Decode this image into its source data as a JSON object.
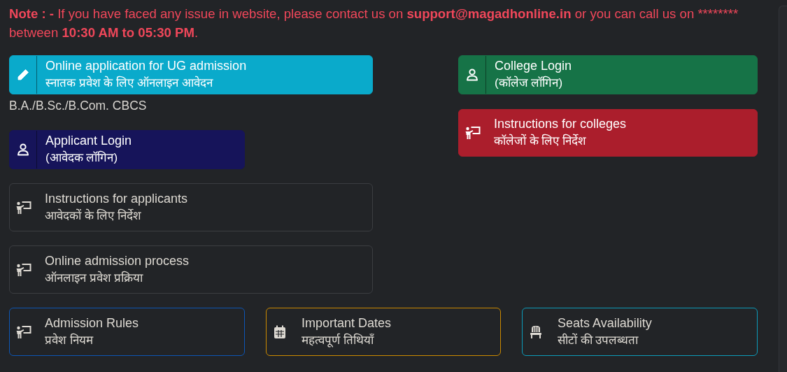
{
  "note": [
    {
      "text": "Note : - ",
      "bold": true
    },
    {
      "text": "If you have faced any issue in website, please contact us on ",
      "bold": false
    },
    {
      "text": "support@magadhonline.in",
      "bold": true
    },
    {
      "text": " or you can call us on ******** between ",
      "bold": false
    },
    {
      "text": "10:30 AM to 05:30 PM",
      "bold": true
    },
    {
      "text": ".",
      "bold": false
    }
  ],
  "left_column": [
    {
      "kind": "solid",
      "icon": {
        "kind": "pencil"
      },
      "separator": true,
      "color": "#0aaacb",
      "title": "Online application for UG admission",
      "subtitle": "स्नातक प्रवेश के लिए ऑनलाइन आवेदन",
      "caption": "B.A./B.Sc./B.Com. CBCS"
    },
    {
      "kind": "solid",
      "icon": {
        "kind": "person"
      },
      "separator": true,
      "color": "#16145a",
      "title": "Applicant Login",
      "subtitle": "(आवेदक लॉगिन)"
    },
    {
      "kind": "plain",
      "icon": {
        "kind": "teacher"
      },
      "separator": false,
      "title": "Instructions for applicants",
      "subtitle": "आवेदकों के लिए निर्देश"
    },
    {
      "kind": "plain",
      "icon": {
        "kind": "teacher"
      },
      "separator": false,
      "title": "Online admission process",
      "subtitle": "ऑनलाइन प्रवेश प्रक्रिया"
    }
  ],
  "right_column": [
    {
      "kind": "solid",
      "icon": {
        "kind": "person"
      },
      "separator": true,
      "color": "#167347",
      "title": "College Login",
      "subtitle": "(कॉलेज लॉगिन)"
    },
    {
      "kind": "solid",
      "icon": {
        "kind": "teacher"
      },
      "separator": false,
      "color": "#ab1e2c",
      "title": "Instructions for colleges",
      "subtitle": "कॉलेजों के लिए निर्देश"
    }
  ],
  "bottom_row": [
    {
      "kind": "outline",
      "icon": {
        "kind": "teacher"
      },
      "separator": false,
      "color": "#0d56b5",
      "title": "Admission Rules",
      "subtitle": "प्रवेश नियम"
    },
    {
      "kind": "outline",
      "icon": {
        "kind": "calendar"
      },
      "separator": false,
      "color": "#cc8a00",
      "title": "Important Dates",
      "subtitle": "महत्वपूर्ण तिथियाँ"
    },
    {
      "kind": "outline",
      "icon": {
        "kind": "chair"
      },
      "separator": false,
      "color": "#0c9cba",
      "title": "Seats Availability",
      "subtitle": "सीटों की उपलब्धता"
    }
  ]
}
